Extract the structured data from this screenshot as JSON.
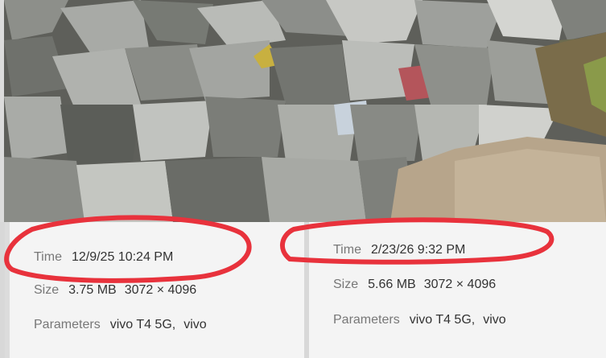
{
  "photo": {
    "subject": "garbage-dump-photo"
  },
  "left_card": {
    "time_label": "Time",
    "time_value": "12/9/25 10:24 PM",
    "size_label": "Size",
    "size_value": "3.75 MB",
    "resolution": "3072 × 4096",
    "params_label": "Parameters",
    "device": "vivo T4 5G,",
    "brand": "vivo"
  },
  "right_card": {
    "time_label": "Time",
    "time_value": "2/23/26 9:32 PM",
    "size_label": "Size",
    "size_value": "5.66 MB",
    "resolution": "3072 × 4096",
    "params_label": "Parameters",
    "device": "vivo T4 5G,",
    "brand": "vivo"
  },
  "colors": {
    "marker": "#e8323c",
    "panel": "#f4f4f4"
  }
}
